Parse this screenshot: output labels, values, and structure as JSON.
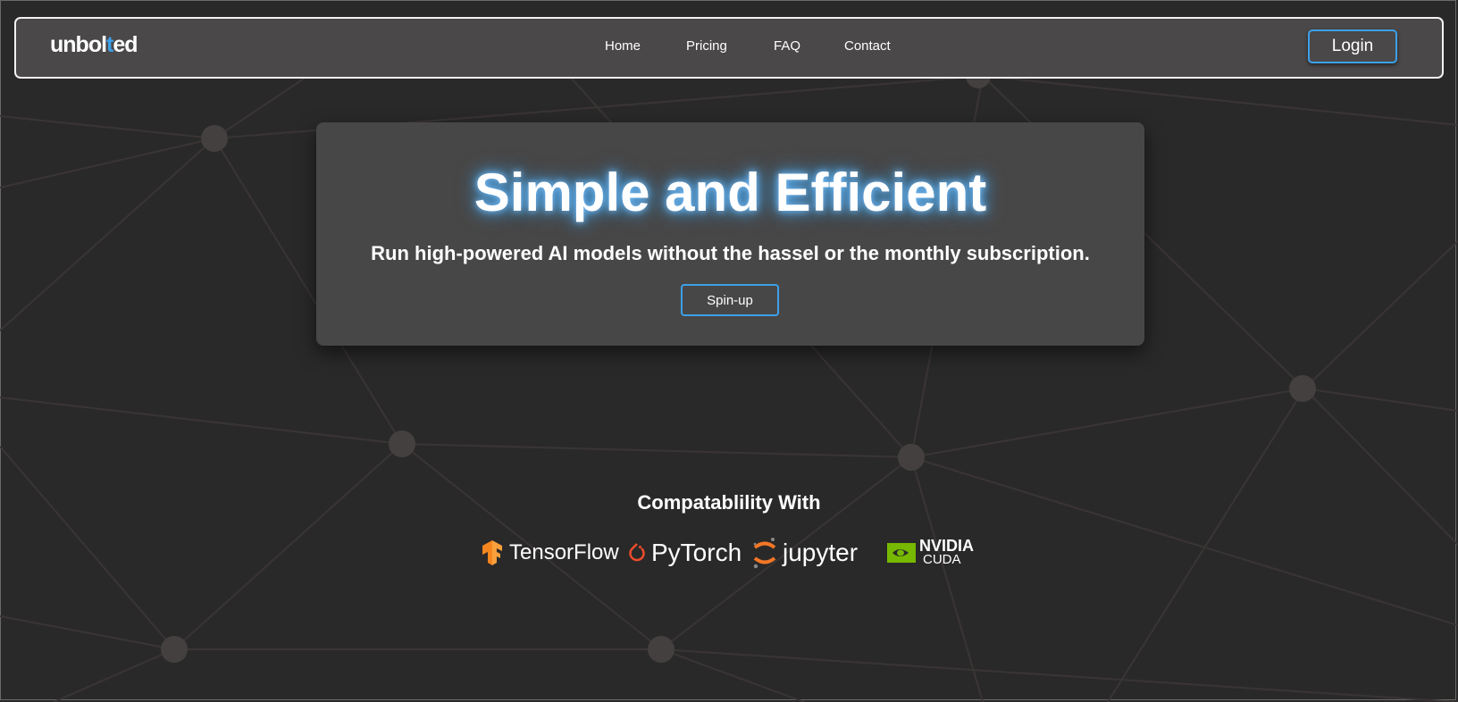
{
  "brand": {
    "logo_pre": "unbol",
    "logo_accent": "t",
    "logo_post": "ed"
  },
  "nav": {
    "items": [
      "Home",
      "Pricing",
      "FAQ",
      "Contact"
    ],
    "login_label": "Login"
  },
  "hero": {
    "title_a": "Simple",
    "title_b": " and ",
    "title_c": "Efficient",
    "subtitle": "Run high-powered AI models without the hassel or the monthly subscription.",
    "cta_label": "Spin-up"
  },
  "compat": {
    "title": "Compatablility With",
    "logos": [
      {
        "icon": "tensorflow-icon",
        "text": "TensorFlow"
      },
      {
        "icon": "pytorch-icon",
        "text": "PyTorch"
      },
      {
        "icon": "jupyter-icon",
        "text": "jupyter"
      },
      {
        "icon": "nvidia-icon",
        "text": "NVIDIA",
        "text2": "CUDA"
      }
    ]
  },
  "colors": {
    "accent": "#3da0e8",
    "background": "#2a2929",
    "navbar": "#4a4848",
    "hero_card": "#484747",
    "tensorflow": "#f5861f",
    "pytorch": "#ee4c2c",
    "jupyter": "#f37726",
    "nvidia": "#76b900"
  }
}
